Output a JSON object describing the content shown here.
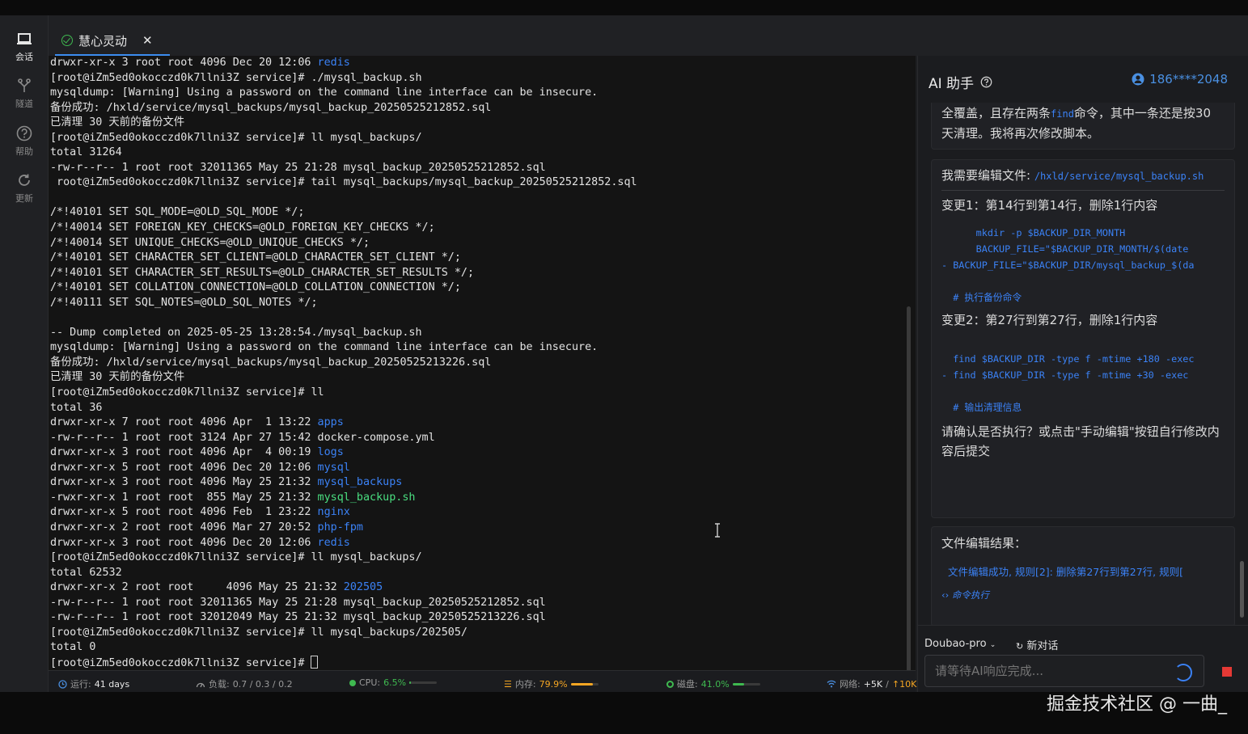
{
  "sidebar": {
    "items": [
      {
        "label": "会话",
        "icon": "laptop-icon",
        "active": true
      },
      {
        "label": "隧道",
        "icon": "tunnel-icon",
        "active": false
      },
      {
        "label": "帮助",
        "icon": "help-icon",
        "active": false
      },
      {
        "label": "更新",
        "icon": "refresh-icon",
        "active": false
      }
    ]
  },
  "tab": {
    "title": "慧心灵动",
    "status_icon": "check-circle-icon",
    "close": "✕"
  },
  "terminal": {
    "lines": [
      [
        {
          "t": "drwxr-xr-x 3 root root 4096 Dec 20 12:06 "
        },
        {
          "t": "redis",
          "c": "blue"
        }
      ],
      [
        {
          "t": "[root@iZm5ed0okocczd0k7llni3Z service]# ./mysql_backup.sh"
        }
      ],
      [
        {
          "t": "mysqldump: [Warning] Using a password on the command line interface can be insecure."
        }
      ],
      [
        {
          "t": "备份成功: /hxld/service/mysql_backups/mysql_backup_20250525212852.sql"
        }
      ],
      [
        {
          "t": "已清理 30 天前的备份文件"
        }
      ],
      [
        {
          "t": "[root@iZm5ed0okocczd0k7llni3Z service]# ll mysql_backups/"
        }
      ],
      [
        {
          "t": "total 31264"
        }
      ],
      [
        {
          "t": "-rw-r--r-- 1 root root 32011365 May 25 21:28 mysql_backup_20250525212852.sql"
        }
      ],
      [
        {
          "t": " root@iZm5ed0okocczd0k7llni3Z service]# tail mysql_backups/mysql_backup_20250525212852.sql"
        }
      ],
      [
        {
          "t": ""
        }
      ],
      [
        {
          "t": "/*!40101 SET SQL_MODE=@OLD_SQL_MODE */;"
        }
      ],
      [
        {
          "t": "/*!40014 SET FOREIGN_KEY_CHECKS=@OLD_FOREIGN_KEY_CHECKS */;"
        }
      ],
      [
        {
          "t": "/*!40014 SET UNIQUE_CHECKS=@OLD_UNIQUE_CHECKS */;"
        }
      ],
      [
        {
          "t": "/*!40101 SET CHARACTER_SET_CLIENT=@OLD_CHARACTER_SET_CLIENT */;"
        }
      ],
      [
        {
          "t": "/*!40101 SET CHARACTER_SET_RESULTS=@OLD_CHARACTER_SET_RESULTS */;"
        }
      ],
      [
        {
          "t": "/*!40101 SET COLLATION_CONNECTION=@OLD_COLLATION_CONNECTION */;"
        }
      ],
      [
        {
          "t": "/*!40111 SET SQL_NOTES=@OLD_SQL_NOTES */;"
        }
      ],
      [
        {
          "t": ""
        }
      ],
      [
        {
          "t": "-- Dump completed on 2025-05-25 13:28:54./mysql_backup.sh"
        }
      ],
      [
        {
          "t": "mysqldump: [Warning] Using a password on the command line interface can be insecure."
        }
      ],
      [
        {
          "t": "备份成功: /hxld/service/mysql_backups/mysql_backup_20250525213226.sql"
        }
      ],
      [
        {
          "t": "已清理 30 天前的备份文件"
        }
      ],
      [
        {
          "t": "[root@iZm5ed0okocczd0k7llni3Z service]# ll"
        }
      ],
      [
        {
          "t": "total 36"
        }
      ],
      [
        {
          "t": "drwxr-xr-x 7 root root 4096 Apr  1 13:22 "
        },
        {
          "t": "apps",
          "c": "blue"
        }
      ],
      [
        {
          "t": "-rw-r--r-- 1 root root 3124 Apr 27 15:42 docker-compose.yml"
        }
      ],
      [
        {
          "t": "drwxr-xr-x 3 root root 4096 Apr  4 00:19 "
        },
        {
          "t": "logs",
          "c": "blue"
        }
      ],
      [
        {
          "t": "drwxr-xr-x 5 root root 4096 Dec 20 12:06 "
        },
        {
          "t": "mysql",
          "c": "blue"
        }
      ],
      [
        {
          "t": "drwxr-xr-x 3 root root 4096 May 25 21:32 "
        },
        {
          "t": "mysql_backups",
          "c": "blue"
        }
      ],
      [
        {
          "t": "-rwxr-xr-x 1 root root  855 May 25 21:32 "
        },
        {
          "t": "mysql_backup.sh",
          "c": "green"
        }
      ],
      [
        {
          "t": "drwxr-xr-x 5 root root 4096 Feb  1 23:22 "
        },
        {
          "t": "nginx",
          "c": "blue"
        }
      ],
      [
        {
          "t": "drwxr-xr-x 2 root root 4096 Mar 27 20:52 "
        },
        {
          "t": "php-fpm",
          "c": "blue"
        }
      ],
      [
        {
          "t": "drwxr-xr-x 3 root root 4096 Dec 20 12:06 "
        },
        {
          "t": "redis",
          "c": "blue"
        }
      ],
      [
        {
          "t": "[root@iZm5ed0okocczd0k7llni3Z service]# ll mysql_backups/"
        }
      ],
      [
        {
          "t": "total 62532"
        }
      ],
      [
        {
          "t": "drwxr-xr-x 2 root root     4096 May 25 21:32 "
        },
        {
          "t": "202505",
          "c": "blue"
        }
      ],
      [
        {
          "t": "-rw-r--r-- 1 root root 32011365 May 25 21:28 mysql_backup_20250525212852.sql"
        }
      ],
      [
        {
          "t": "-rw-r--r-- 1 root root 32012049 May 25 21:32 mysql_backup_20250525213226.sql"
        }
      ],
      [
        {
          "t": "[root@iZm5ed0okocczd0k7llni3Z service]# ll mysql_backups/202505/"
        }
      ],
      [
        {
          "t": "total 0"
        }
      ],
      [
        {
          "t": "[root@iZm5ed0okocczd0k7llni3Z service]# "
        },
        {
          "t": "",
          "c": "cursor"
        }
      ]
    ]
  },
  "status": {
    "uptime_label": "运行:",
    "uptime_value": "41 days",
    "load_label": "负载:",
    "load_value": "0.7 / 0.3 / 0.2",
    "cpu_label": "CPU:",
    "cpu_value": "6.5%",
    "cpu_fraction": 0.065,
    "cpu_color": "#3fb950",
    "mem_label": "内存:",
    "mem_value": "79.9%",
    "mem_fraction": 0.799,
    "mem_color": "#f5a623",
    "disk_label": "磁盘:",
    "disk_value": "41.0%",
    "disk_fraction": 0.41,
    "disk_color": "#3fb950",
    "net_label": "网络:",
    "net_down": "+5K",
    "net_sep": "/",
    "net_up": "↑10K"
  },
  "ai": {
    "title": "AI 助手",
    "help_icon": "help-icon",
    "user": "186****2048",
    "msg1_a": "全覆盖，且存在两条",
    "msg1_code": "find",
    "msg1_b": "命令，其中一条还是按30 天清理。我将再次修改脚本。",
    "edit_label": "我需要编辑文件: ",
    "edit_path": "/hxld/service/mysql_backup.sh",
    "change1": "变更1：第14行到第14行，删除1行内容",
    "change1_code": [
      "      mkdir -p $BACKUP_DIR_MONTH",
      "      BACKUP_FILE=\"$BACKUP_DIR_MONTH/$(date",
      "- BACKUP_FILE=\"$BACKUP_DIR/mysql_backup_$(da",
      "",
      "  # 执行备份命令"
    ],
    "change2": "变更2：第27行到第27行，删除1行内容",
    "change2_code": [
      "",
      "  find $BACKUP_DIR -type f -mtime +180 -exec",
      "- find $BACKUP_DIR -type f -mtime +30 -exec",
      "",
      "  # 输出清理信息"
    ],
    "confirm": "请确认是否执行？或点击\"手动编辑\"按钮自行修改内容后提交",
    "result_title": "文件编辑结果：",
    "result_text": "文件编辑成功, 规则[2]: 删除第27行到第27行, 规则[",
    "cmd_label": "命令执行",
    "model": "Doubao-pro",
    "new_chat": "新对话",
    "input_placeholder": "请等待AI响应完成..."
  },
  "watermark": "掘金技术社区 @ 一曲_"
}
